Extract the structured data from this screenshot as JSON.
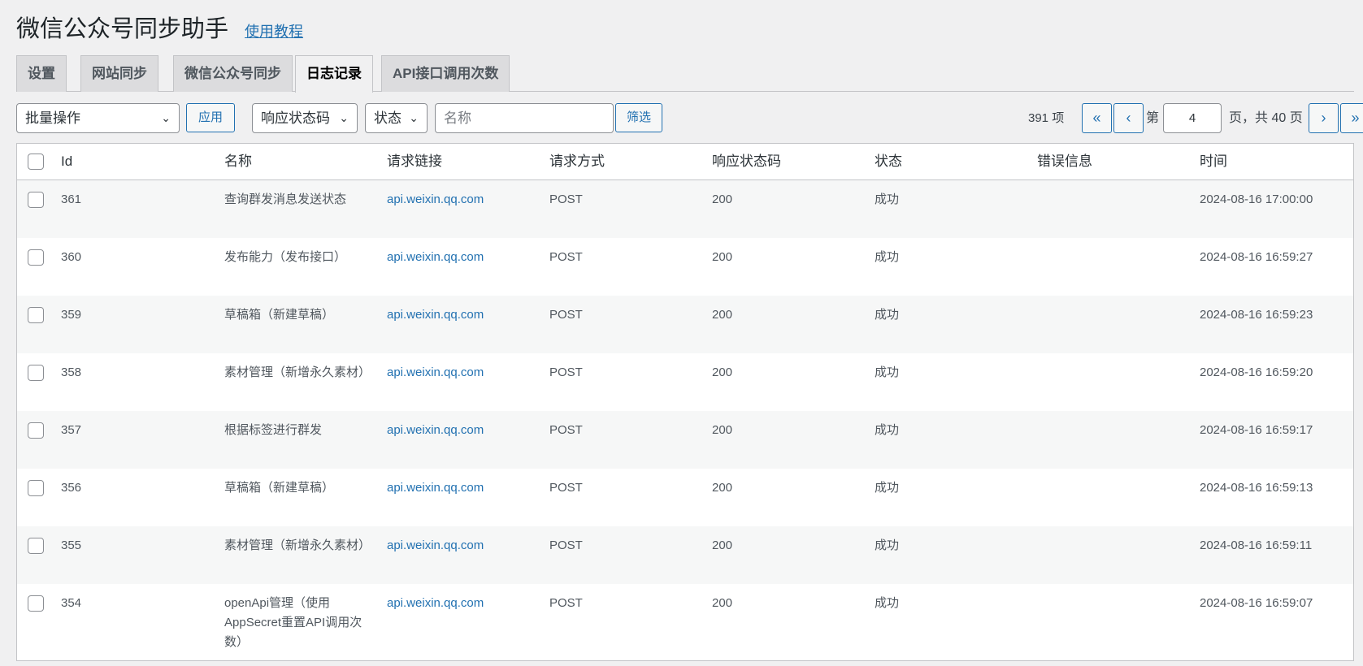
{
  "header": {
    "title": "微信公众号同步助手",
    "tutorial_link": "使用教程"
  },
  "tabs": [
    {
      "label": "设置"
    },
    {
      "label": "网站同步"
    },
    {
      "label": "微信公众号同步"
    },
    {
      "label": "日志记录",
      "active": true
    },
    {
      "label": "API接口调用次数"
    }
  ],
  "toolbar": {
    "bulk_action": "批量操作",
    "apply_label": "应用",
    "status_code_filter": "响应状态码",
    "status_filter": "状态",
    "name_placeholder": "名称",
    "filter_label": "筛选"
  },
  "pagination": {
    "items": "391 项",
    "first": "«",
    "prev": "‹",
    "page_prefix": "第",
    "current_page": "4",
    "page_suffix": "页，共 40 页",
    "next": "›",
    "last": "»"
  },
  "table": {
    "columns": [
      "Id",
      "名称",
      "请求链接",
      "请求方式",
      "响应状态码",
      "状态",
      "错误信息",
      "时间"
    ],
    "rows": [
      {
        "id": "361",
        "name": "查询群发消息发送状态",
        "url": "api.weixin.qq.com",
        "method": "POST",
        "code": "200",
        "status": "成功",
        "error": "",
        "time": "2024-08-16 17:00:00"
      },
      {
        "id": "360",
        "name": "发布能力（发布接口）",
        "url": "api.weixin.qq.com",
        "method": "POST",
        "code": "200",
        "status": "成功",
        "error": "",
        "time": "2024-08-16 16:59:27"
      },
      {
        "id": "359",
        "name": "草稿箱（新建草稿）",
        "url": "api.weixin.qq.com",
        "method": "POST",
        "code": "200",
        "status": "成功",
        "error": "",
        "time": "2024-08-16 16:59:23"
      },
      {
        "id": "358",
        "name": "素材管理（新增永久素材）",
        "url": "api.weixin.qq.com",
        "method": "POST",
        "code": "200",
        "status": "成功",
        "error": "",
        "time": "2024-08-16 16:59:20"
      },
      {
        "id": "357",
        "name": "根据标签进行群发",
        "url": "api.weixin.qq.com",
        "method": "POST",
        "code": "200",
        "status": "成功",
        "error": "",
        "time": "2024-08-16 16:59:17"
      },
      {
        "id": "356",
        "name": "草稿箱（新建草稿）",
        "url": "api.weixin.qq.com",
        "method": "POST",
        "code": "200",
        "status": "成功",
        "error": "",
        "time": "2024-08-16 16:59:13"
      },
      {
        "id": "355",
        "name": "素材管理（新增永久素材）",
        "url": "api.weixin.qq.com",
        "method": "POST",
        "code": "200",
        "status": "成功",
        "error": "",
        "time": "2024-08-16 16:59:11"
      },
      {
        "id": "354",
        "name": "openApi管理（使用AppSecret重置API调用次数）",
        "url": "api.weixin.qq.com",
        "method": "POST",
        "code": "200",
        "status": "成功",
        "error": "",
        "time": "2024-08-16 16:59:07"
      }
    ]
  }
}
